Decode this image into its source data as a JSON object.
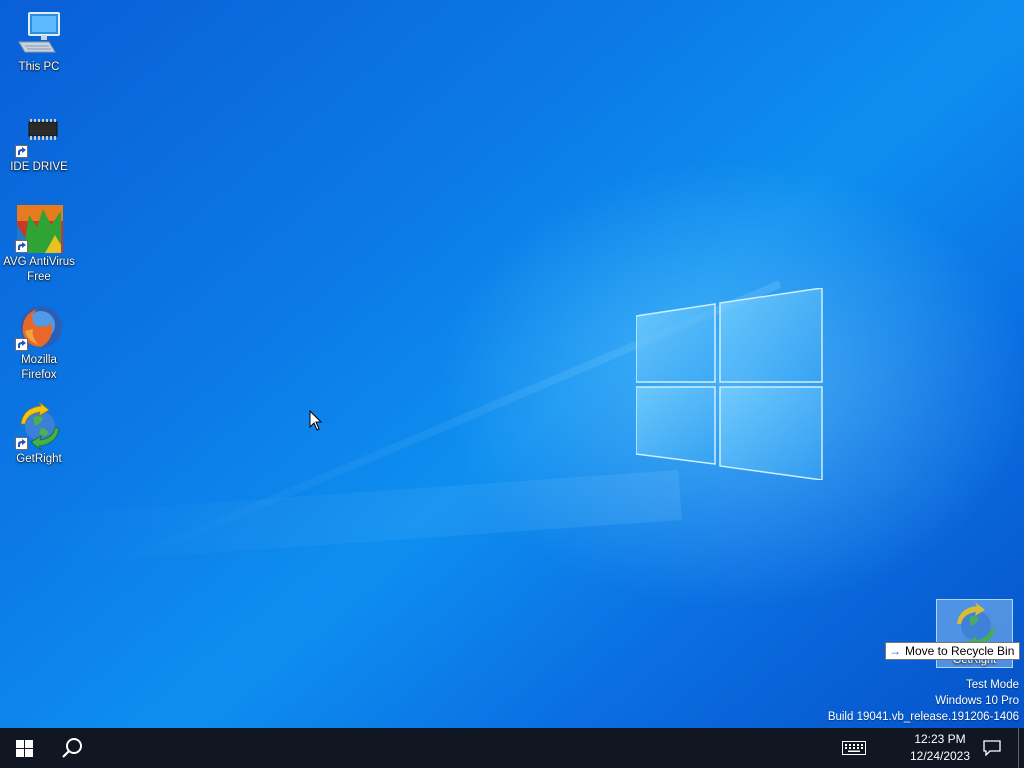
{
  "desktop": {
    "icons": [
      {
        "label": "This PC",
        "icon": "computer-icon"
      },
      {
        "label": "IDE DRIVE",
        "icon": "chip-drive-icon"
      },
      {
        "label": "AVG AntiVirus\nFree",
        "icon": "avg-antivirus-icon"
      },
      {
        "label": "Mozilla\nFirefox",
        "icon": "firefox-icon"
      },
      {
        "label": "GetRight",
        "icon": "getright-icon"
      }
    ],
    "drag": {
      "label": "GetRight",
      "tooltip": "Move to Recycle Bin",
      "tooltip_icon": "arrow-right-icon"
    },
    "watermark": {
      "line1": "Test Mode",
      "line2": "Windows 10 Pro",
      "line3": "Build 19041.vb_release.191206-1406"
    },
    "wallpaper_colors": {
      "dark": "#0652c8",
      "mid": "#0e8ff0",
      "glow": "#78d2ff"
    }
  },
  "taskbar": {
    "start_icon": "windows-start-icon",
    "search_icon": "search-icon",
    "keyboard_icon": "touch-keyboard-icon",
    "time": "12:23 PM",
    "date": "12/24/2023",
    "notification_icon": "action-center-icon",
    "background": "#101723"
  }
}
